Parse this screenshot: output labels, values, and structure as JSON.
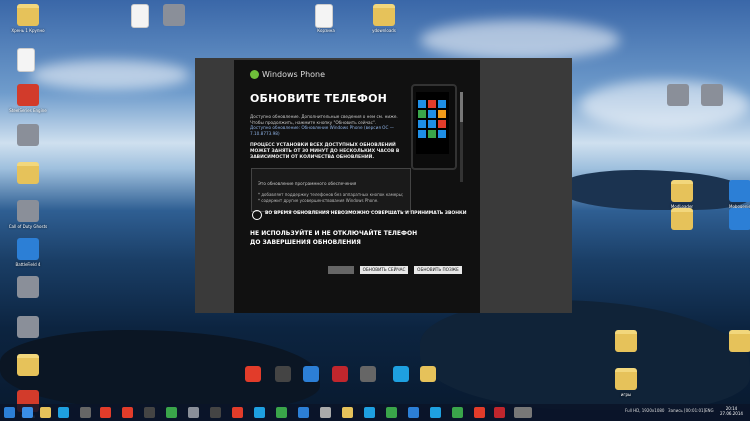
{
  "desktop": {
    "icons_left": [
      {
        "label": "Хрень 1 Крупно",
        "type": "folder"
      },
      {
        "label": "",
        "type": "doc"
      },
      {
        "label": "SteelSeries Engine",
        "type": "app"
      },
      {
        "label": "",
        "type": "gray"
      },
      {
        "label": "",
        "type": "folder"
      },
      {
        "label": "Call of Duty Ghosts",
        "type": "gray"
      },
      {
        "label": "BattleField 4",
        "type": "blue"
      },
      {
        "label": "",
        "type": "gray"
      },
      {
        "label": "",
        "type": "gray"
      },
      {
        "label": "",
        "type": "folder"
      },
      {
        "label": "Yandex",
        "type": "app"
      }
    ],
    "icons_top": [
      {
        "label": "",
        "type": "doc"
      },
      {
        "label": "",
        "type": "gray"
      },
      {
        "label": "Корзина",
        "type": "doc"
      },
      {
        "label": "ydownloads",
        "type": "folder"
      }
    ],
    "icons_right": [
      {
        "label": "",
        "type": "gray"
      },
      {
        "label": "",
        "type": "gray"
      },
      {
        "label": "ModLoader",
        "type": "folder"
      },
      {
        "label": "Mobogenie",
        "type": "blue"
      },
      {
        "label": "",
        "type": "folder"
      },
      {
        "label": "",
        "type": "blue"
      },
      {
        "label": "",
        "type": "folder"
      },
      {
        "label": "",
        "type": "folder"
      },
      {
        "label": "игры",
        "type": "folder"
      }
    ]
  },
  "dialog": {
    "brand": "Windows Phone",
    "title": "ОБНОВИТЕ ТЕЛЕФОН",
    "desc_line1": "Доступно обновление. Дополнительные сведения о нем см. ниже.",
    "desc_line2": "Чтобы продолжить, нажмите кнопку \"Обновить сейчас\".",
    "desc_link": "Доступно обновление: Обновление Windows Phone (версия ОС —",
    "desc_link2": "7.10.8773.98)",
    "warn_install": "ПРОЦЕСС УСТАНОВКИ ВСЕХ ДОСТУПНЫХ ОБНОВЛЕНИЙ МОЖЕТ ЗАНЯТЬ ОТ 30 МИНУТ ДО НЕСКОЛЬКИХ ЧАСОВ В ЗАВИСИМОСТИ ОТ КОЛИЧЕСТВА ОБНОВЛЕНИЙ.",
    "notes_title": "Это обновление программного обеспечения",
    "note1": "* добавляет поддержку телефонов без аппаратных кнопок камеры;",
    "note2": "* содержит другие усовершенствования Windows Phone.",
    "alert": "ВО ВРЕМЯ ОБНОВЛЕНИЯ НЕВОЗМОЖНО СОВЕРШАТЬ И ПРИНИМАТЬ ЗВОНКИ",
    "warn_disconnect": "НЕ ИСПОЛЬЗУЙТЕ И НЕ ОТКЛЮЧАЙТЕ ТЕЛЕФОН ДО ЗАВЕРШЕНИЯ ОБНОВЛЕНИЯ",
    "btn_disabled": "",
    "btn_now": "ОБНОВИТЬ СЕЙЧАС",
    "btn_later": "ОБНОВИТЬ ПОЗЖЕ"
  },
  "taskbar": {
    "tray_resolution": "Full HD, 1920x1080",
    "tray_record": "Запись [00:01:01]",
    "lang": "ENG",
    "time": "20:14",
    "date": "27.06.2014"
  },
  "colors": {
    "accent": "#6fc03a",
    "dialog_bg": "#111111",
    "button_bg": "#e8e8e8"
  }
}
